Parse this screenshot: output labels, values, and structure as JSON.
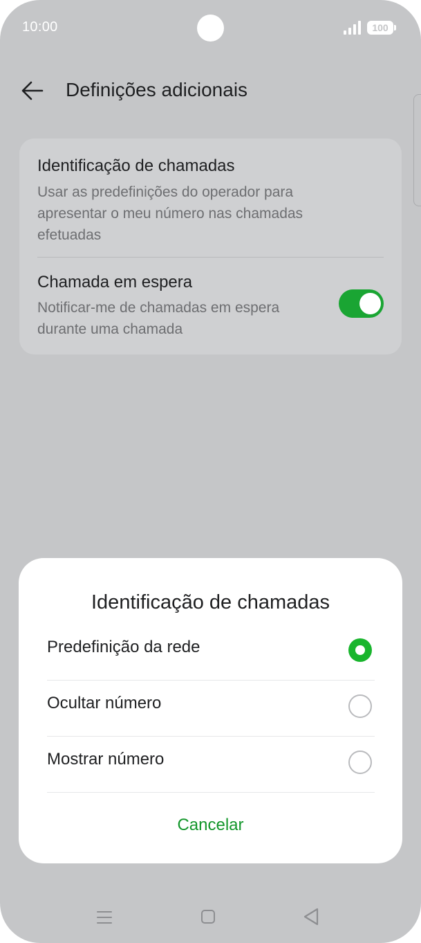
{
  "status_bar": {
    "time": "10:00",
    "battery": "100",
    "icons": [
      "signal-icon",
      "battery-icon"
    ]
  },
  "header": {
    "title": "Definições adicionais",
    "back_icon": "arrow-left-icon"
  },
  "settings": {
    "caller_id": {
      "title": "Identificação de chamadas",
      "subtitle_lines": [
        "Usar as predefinições do operador para",
        "apresentar o meu número nas chamadas",
        "efetuadas"
      ]
    },
    "call_waiting": {
      "title": "Chamada em espera",
      "subtitle_lines": [
        "Notificar-me de chamadas em espera",
        "durante uma chamada"
      ],
      "enabled": true
    }
  },
  "dialog": {
    "title": "Identificação de chamadas",
    "options": [
      {
        "label": "Predefinição da rede",
        "selected": true
      },
      {
        "label": "Ocultar número",
        "selected": false
      },
      {
        "label": "Mostrar número",
        "selected": false
      }
    ],
    "cancel_label": "Cancelar"
  },
  "nav_bar": {
    "icons": [
      "menu-icon",
      "home-icon",
      "back-triangle-icon"
    ]
  },
  "colors": {
    "background": "#c5c6c8",
    "accent_green": "#19b52d",
    "cancel_green": "#12962a",
    "toggle_on": "#1aa533"
  }
}
